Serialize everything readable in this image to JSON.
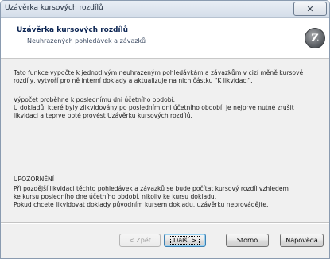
{
  "window": {
    "title": "Uzávěrka kursových rozdílů",
    "close_glyph": "✕"
  },
  "header": {
    "title": "Uzávěrka kursových rozdílů",
    "subtitle": "Neuhrazených pohledávek a závazků",
    "logo_glyph": "Z"
  },
  "body": {
    "p1": "Tato funkce vypočte k jednotlivým neuhrazeným pohledávkám a závazkům v cizí měně kursové\nrozdíly, vytvoří pro ně interní doklady a aktualizuje na nich částku \"K likvidaci\".",
    "p2": "Výpočet proběhne k poslednímu dni účetního období.\nU dokladů, které byly zlikvidovány po posledním dni účetního období, je nejprve nutné zrušit\nlikvidaci a teprve poté provést Uzávěrku kursových rozdílů.",
    "warning_heading": "UPOZORNĚNÍ",
    "p3": "Při pozdější likvidaci těchto pohledávek a závazků se bude počítat kursový rozdíl vzhledem\nke kursu posledního dne účetního období, nikoliv ke kursu dokladu.\nPokud chcete likvidovat doklady původním kursem dokladu, uzávěrku neprovádějte."
  },
  "buttons": {
    "back": "< Zpět",
    "next": "Další >",
    "cancel": "Storno",
    "help": "Nápověda"
  }
}
